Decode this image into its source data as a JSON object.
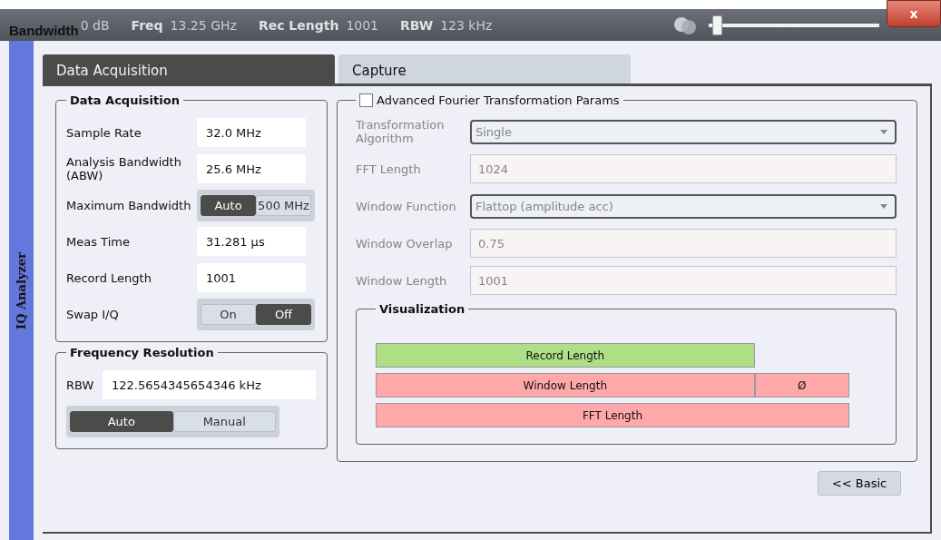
{
  "status_bar": {
    "title": "Bandwidth",
    "items": [
      {
        "value": "0 dB"
      },
      {
        "label": "Freq",
        "value": "13.25 GHz"
      },
      {
        "label": "Rec Length",
        "value": "1001"
      },
      {
        "label": "RBW",
        "value": "123 kHz"
      }
    ],
    "slider": {
      "level": 0.02
    },
    "close": "x"
  },
  "side_tab": "IQ Analyzer",
  "tabs": [
    {
      "label": "Data Acquisition",
      "selected": true
    },
    {
      "label": "Capture",
      "selected": false
    }
  ],
  "data_acquisition": {
    "title": "Data Acquisition",
    "rows": [
      {
        "kind": "field",
        "label": "Sample Rate",
        "value": "32.0 MHz"
      },
      {
        "kind": "field",
        "label": "Analysis Bandwidth (ABW)",
        "value": "25.6 MHz"
      },
      {
        "kind": "toggle",
        "label": "Maximum Bandwidth",
        "options": [
          {
            "label": "Auto",
            "selected": true
          },
          {
            "label": "500 MHz",
            "selected": false
          }
        ]
      },
      {
        "kind": "field",
        "label": "Meas Time",
        "value": "31.281 µs"
      },
      {
        "kind": "field",
        "label": "Record Length",
        "value": "1001"
      },
      {
        "kind": "toggle",
        "label": "Swap I/Q",
        "options": [
          {
            "label": "On",
            "selected": false
          },
          {
            "label": "Off",
            "selected": true
          }
        ]
      }
    ]
  },
  "frequency_resolution": {
    "title": "Frequency Resolution",
    "label": "RBW",
    "value": "122.5654345654346 kHz",
    "options": [
      {
        "label": "Auto",
        "selected": true
      },
      {
        "label": "Manual",
        "selected": false
      }
    ]
  },
  "advanced": {
    "title": "Advanced Fourier Transformation Params",
    "checked": false,
    "rows": [
      {
        "kind": "dropdown",
        "label": "Transformation Algorithm",
        "value": "Single",
        "disabled": true
      },
      {
        "kind": "field",
        "label": "FFT Length",
        "value": "1024",
        "disabled": true
      },
      {
        "kind": "dropdown",
        "label": "Window Function",
        "value": "Flattop (amplitude acc)",
        "disabled": true
      },
      {
        "kind": "field",
        "label": "Window Overlap",
        "value": "0.75",
        "disabled": true
      },
      {
        "kind": "field",
        "label": "Window Length",
        "value": "1001",
        "disabled": true
      }
    ],
    "visualization": {
      "title": "Visualization",
      "bars": [
        {
          "kind": "record",
          "segments": [
            {
              "label": "Record Length",
              "color": "#aedf86"
            }
          ]
        },
        {
          "kind": "window",
          "segments": [
            {
              "label": "Window Length",
              "color": "#ffa8aa"
            },
            {
              "label": "Ø",
              "color": "#ffa8aa"
            }
          ]
        },
        {
          "kind": "fft",
          "segments": [
            {
              "label": "FFT Length",
              "color": "#ffa8aa"
            }
          ]
        }
      ]
    }
  },
  "basic_button": "<< Basic"
}
